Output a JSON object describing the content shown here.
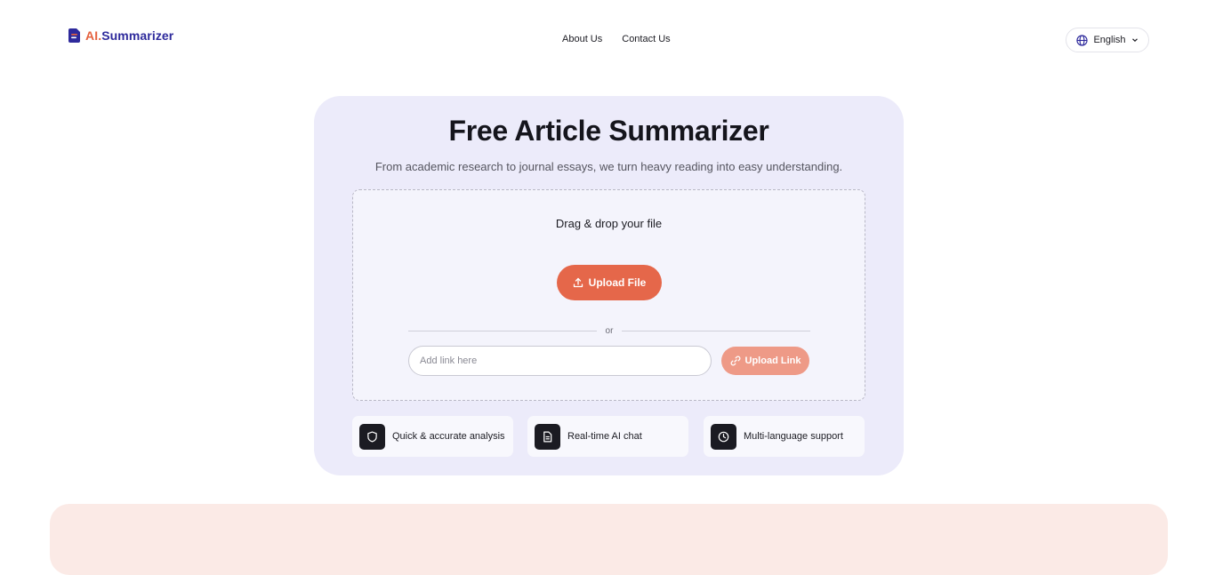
{
  "brand": {
    "ai": "AI.",
    "name": "Summarizer"
  },
  "nav": {
    "about": "About Us",
    "contact": "Contact Us"
  },
  "language": {
    "selected": "English"
  },
  "hero": {
    "title": "Free Article Summarizer",
    "subtitle": "From academic research to journal essays, we turn heavy reading into easy understanding."
  },
  "dropzone": {
    "prompt": "Drag & drop your file",
    "upload_file_label": "Upload File",
    "or_label": "or",
    "link_placeholder": "Add link here",
    "link_value": "",
    "upload_link_label": "Upload Link"
  },
  "features": [
    {
      "label": "Quick & accurate analysis",
      "icon": "shield-icon"
    },
    {
      "label": "Real-time AI chat",
      "icon": "document-icon"
    },
    {
      "label": "Multi-language support",
      "icon": "clock-icon"
    }
  ],
  "colors": {
    "accent": "#e5674a",
    "accent_light": "#ee9a87",
    "brand_blue": "#2e2a9c",
    "hero_bg": "#ecebfa",
    "bottom_panel_bg": "#fbeae6"
  }
}
